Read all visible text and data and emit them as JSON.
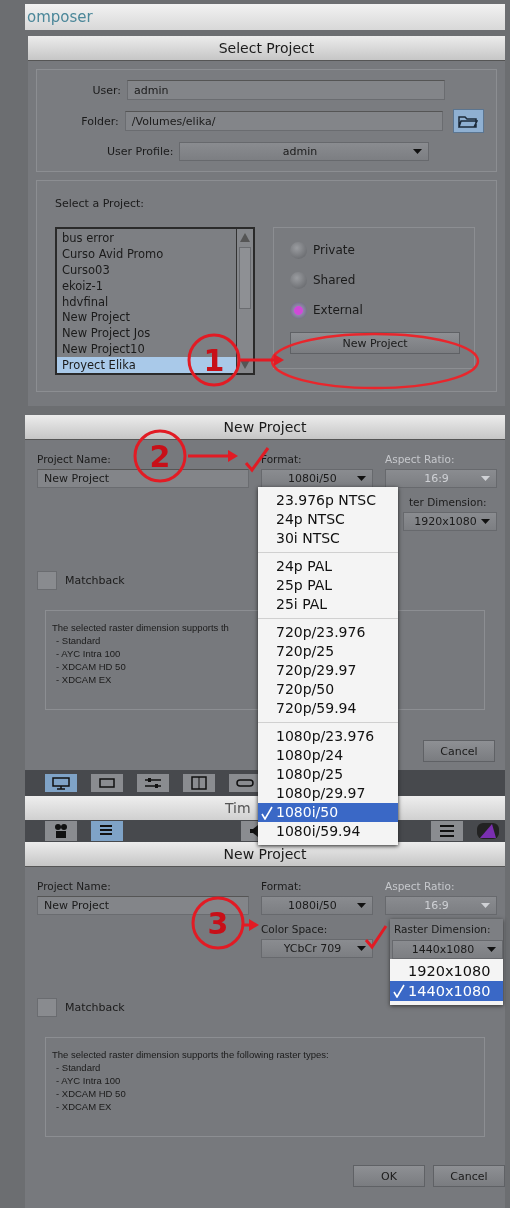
{
  "background_window": {
    "title": "omposer"
  },
  "select_project": {
    "title": "Select Project",
    "fields": [
      {
        "label": "User:",
        "value": "admin"
      },
      {
        "label": "Folder:",
        "value": "/Volumes/elika/"
      }
    ],
    "profile": {
      "label": "User Profile:",
      "value": "admin"
    },
    "list_label": "Select a Project:",
    "projects": [
      {
        "name": "bus error",
        "selected": false
      },
      {
        "name": "Curso Avid Promo",
        "selected": false
      },
      {
        "name": "Curso03",
        "selected": false
      },
      {
        "name": "ekoiz-1",
        "selected": false
      },
      {
        "name": "hdvfinal",
        "selected": false
      },
      {
        "name": "New Project",
        "selected": false
      },
      {
        "name": "New Project Jos",
        "selected": false
      },
      {
        "name": "New Project10",
        "selected": false
      },
      {
        "name": "Proyect Elika",
        "selected": true
      }
    ],
    "types": [
      {
        "label": "Private",
        "selected": false
      },
      {
        "label": "Shared",
        "selected": false
      },
      {
        "label": "External",
        "selected": true
      }
    ],
    "button": "New Project"
  },
  "dialogs": [
    {
      "title": "New Project",
      "name_label": "Project Name:",
      "name": "New Project",
      "format_label": "Format:",
      "format": "1080i/50",
      "aspect_label": "Aspect Ratio:",
      "aspect": "16:9",
      "aspect_disabled": true,
      "raster_label": "ter Dimension:",
      "raster": "1920x1080",
      "matchback_label": "Matchback",
      "matchback_checked": false,
      "info": [
        "The selected raster dimension supports th",
        "- Standard",
        "- AYC Intra 100",
        "- XDCAM HD 50",
        "- XDCAM EX"
      ],
      "buttons": [
        "Cancel"
      ],
      "format_menu": [
        [
          {
            "label": "23.976p NTSC",
            "selected": false
          },
          {
            "label": "24p NTSC",
            "selected": false
          },
          {
            "label": "30i NTSC",
            "selected": false
          }
        ],
        [
          {
            "label": "24p PAL",
            "selected": false
          },
          {
            "label": "25p PAL",
            "selected": false
          },
          {
            "label": "25i PAL",
            "selected": false
          }
        ],
        [
          {
            "label": "720p/23.976",
            "selected": false
          },
          {
            "label": "720p/25",
            "selected": false
          },
          {
            "label": "720p/29.97",
            "selected": false
          },
          {
            "label": "720p/50",
            "selected": false
          },
          {
            "label": "720p/59.94",
            "selected": false
          }
        ],
        [
          {
            "label": "1080p/23.976",
            "selected": false
          },
          {
            "label": "1080p/24",
            "selected": false
          },
          {
            "label": "1080p/25",
            "selected": false
          },
          {
            "label": "1080p/29.97",
            "selected": false
          },
          {
            "label": "1080i/50",
            "selected": true
          },
          {
            "label": "1080i/59.94",
            "selected": false
          }
        ]
      ]
    },
    {
      "title": "New Project",
      "name_label": "Project Name:",
      "name": "New Project",
      "format_label": "Format:",
      "format": "1080i/50",
      "aspect_label": "Aspect Ratio:",
      "aspect": "16:9",
      "aspect_disabled": true,
      "color_space_label": "Color Space:",
      "color_space": "YCbCr 709",
      "matchback_label": "Matchback",
      "matchback_checked": false,
      "info": [
        "The selected raster dimension supports the following raster types:",
        "- Standard",
        "- AYC Intra 100",
        "- XDCAM HD 50",
        "- XDCAM EX"
      ],
      "buttons": [
        "OK",
        "Cancel"
      ],
      "raster_popup": {
        "label": "Raster Dimension:",
        "value": "1440x1080",
        "options": [
          {
            "label": "1920x1080",
            "selected": false
          },
          {
            "label": "1440x1080",
            "selected": true
          }
        ]
      }
    }
  ],
  "timeline_bar": {
    "title": "Tim"
  },
  "annotations": [
    {
      "number": "1"
    },
    {
      "number": "2"
    },
    {
      "number": "3"
    }
  ]
}
